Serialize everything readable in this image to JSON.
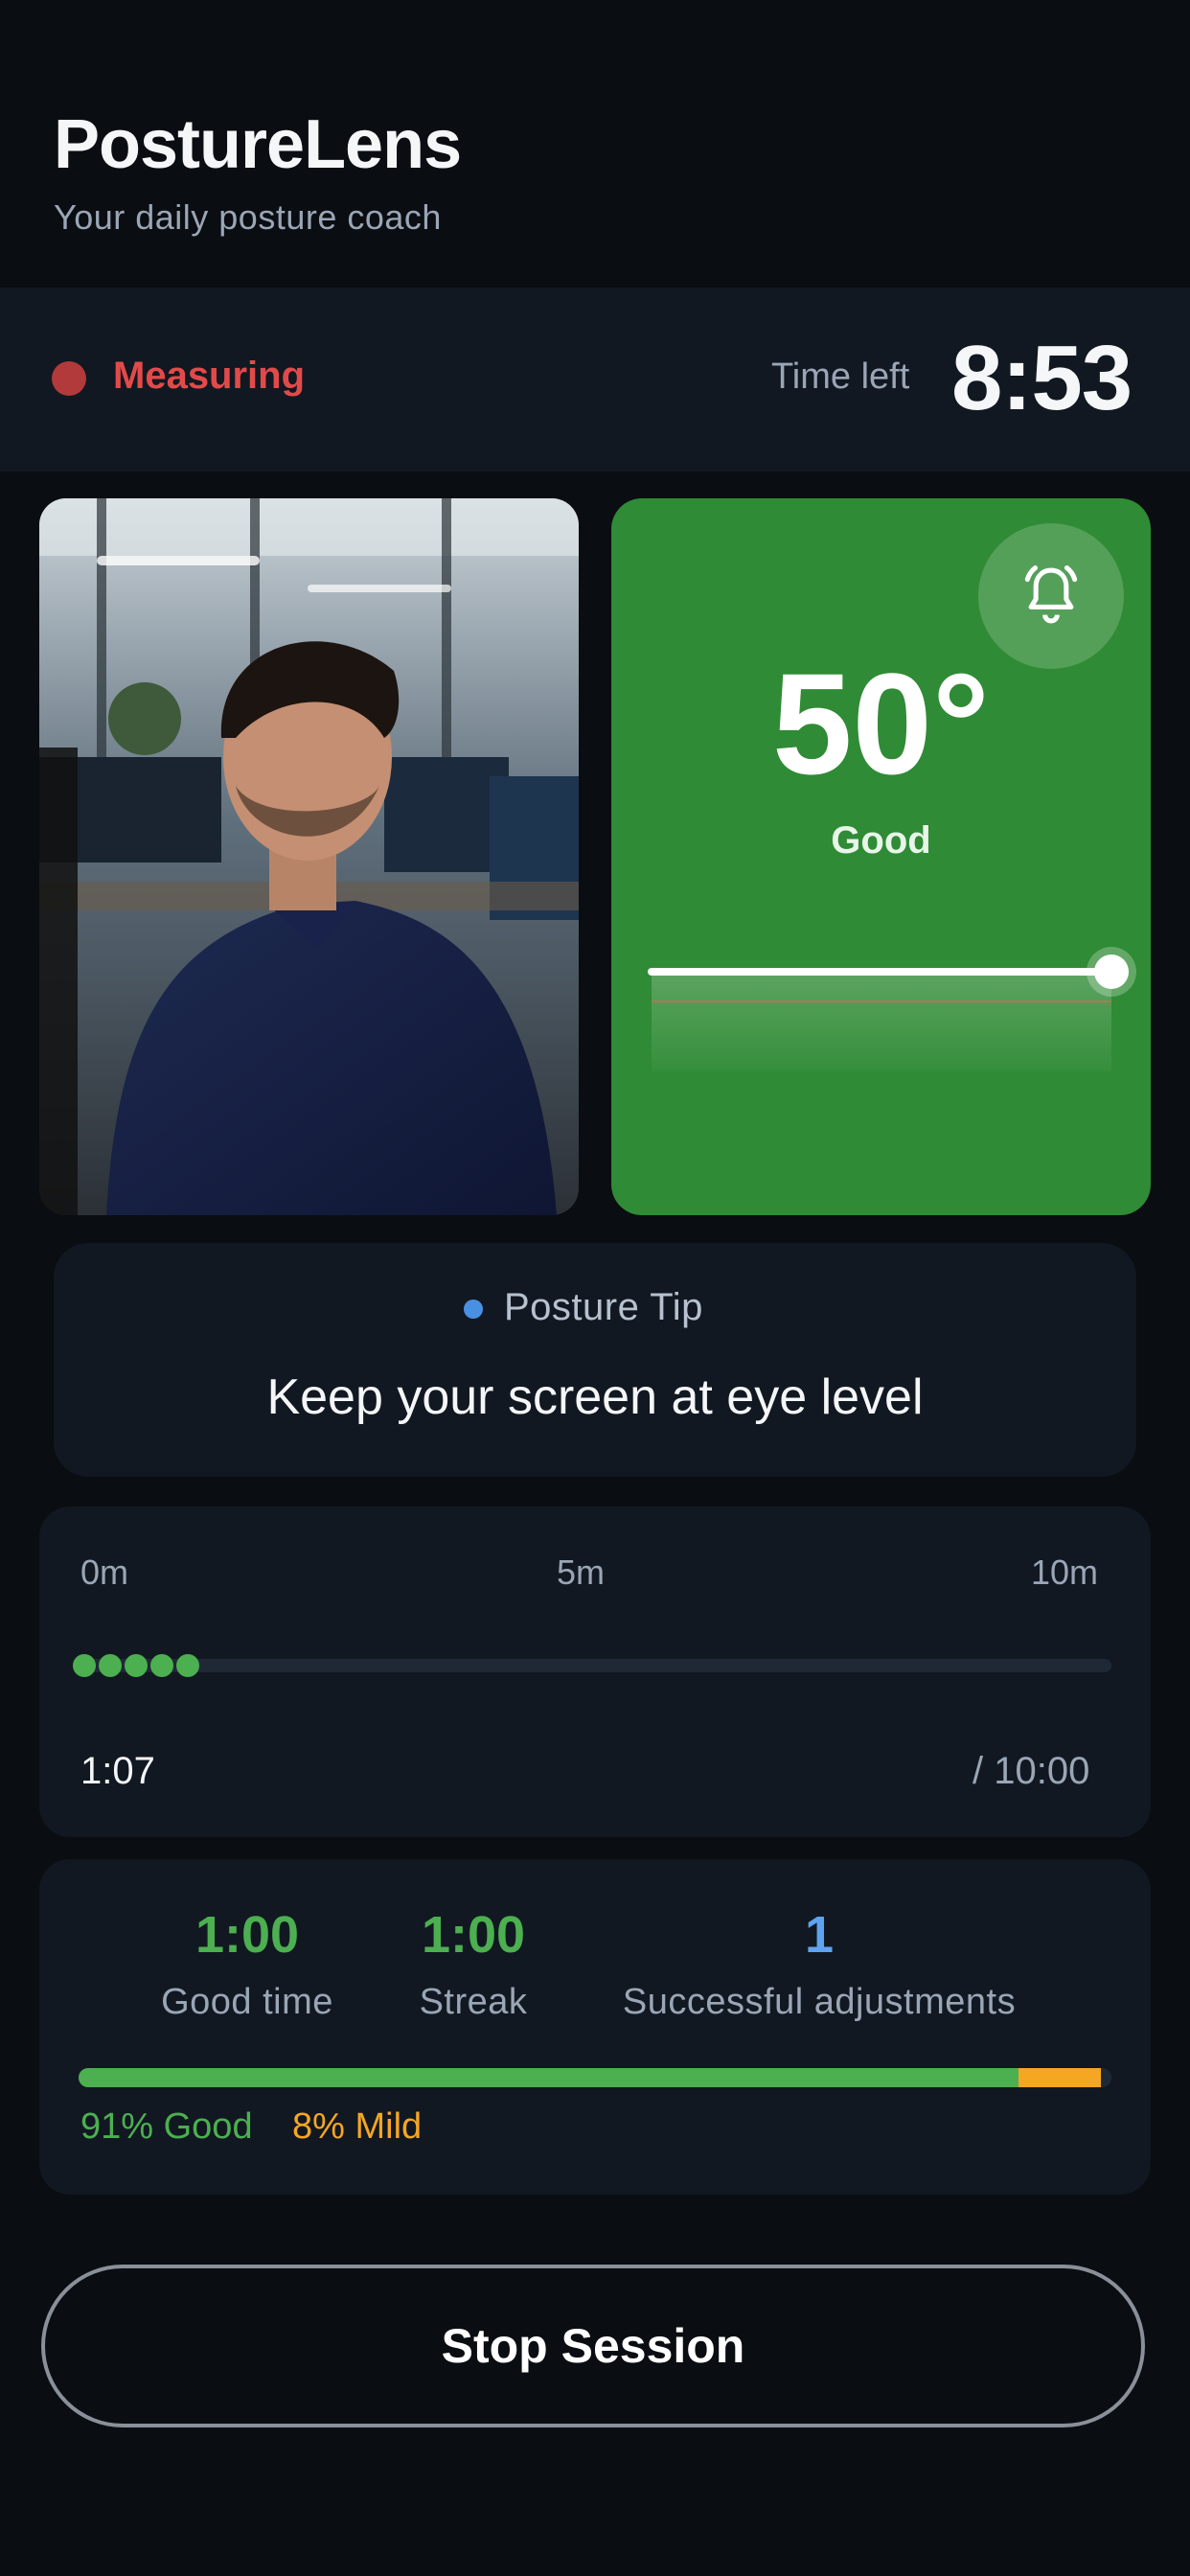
{
  "header": {
    "title": "PostureLens",
    "subtitle": "Your daily posture coach"
  },
  "status": {
    "state": "Measuring",
    "time_left_label": "Time left",
    "time_left_value": "8:53",
    "state_color": "#e24a4a"
  },
  "camera": {
    "description_icon": "camera-preview"
  },
  "angle": {
    "value": "50°",
    "status": "Good",
    "bell_icon": "bell-alert-icon",
    "card_color": "#2f8b35"
  },
  "tip": {
    "label": "Posture Tip",
    "text": "Keep your screen at eye level"
  },
  "timeline": {
    "ticks": [
      "0m",
      "5m",
      "10m"
    ],
    "elapsed": "1:07",
    "total": "/ 10:00",
    "samples": 5
  },
  "stats": {
    "good_time_value": "1:00",
    "good_time_label": "Good time",
    "streak_value": "1:00",
    "streak_label": "Streak",
    "adjustments_value": "1",
    "adjustments_label": "Successful adjustments",
    "good_pct": 91,
    "mild_pct": 8,
    "good_legend": "91% Good",
    "mild_legend": "8% Mild"
  },
  "actions": {
    "stop_label": "Stop Session"
  }
}
